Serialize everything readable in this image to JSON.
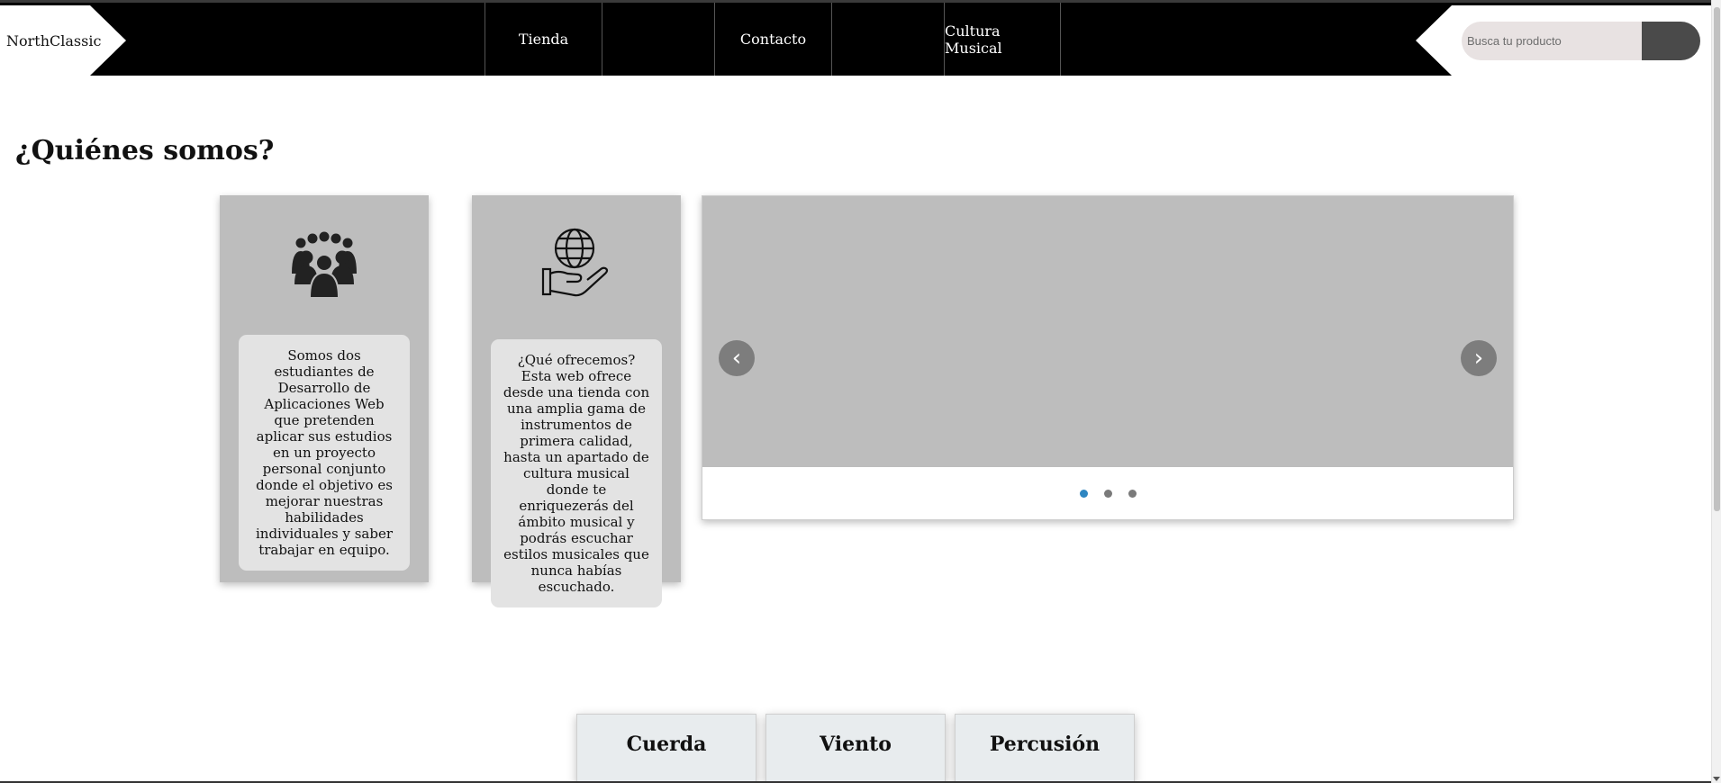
{
  "navbar": {
    "brand": "NorthClassic",
    "links": [
      "Tienda",
      "",
      "Contacto",
      "",
      "Cultura Musical"
    ],
    "search": {
      "placeholder": "Busca tu producto"
    }
  },
  "main": {
    "title": "¿Quiénes somos?",
    "cards": [
      {
        "icon": "people-group-icon",
        "text": "Somos dos estudiantes de Desarrollo de Aplicaciones Web que pretenden aplicar sus estudios en un proyecto personal conjunto donde el objetivo es mejorar nuestras habilidades individuales y saber trabajar en equipo."
      },
      {
        "icon": "globe-in-hand-icon",
        "text": "¿Qué ofrecemos? Esta web ofrece desde una tienda con una amplia gama de instrumentos de primera calidad, hasta un apartado de cultura musical donde te enriquezerás del ámbito musical y podrás escuchar estilos musicales que nunca habías escuchado."
      }
    ],
    "carousel": {
      "prev": "‹",
      "next": "›",
      "slide_count": 3,
      "active_index": 0
    },
    "categories": [
      "Cuerda",
      "Viento",
      "Percusión"
    ]
  },
  "colors": {
    "navbar_bg": "#000000",
    "card_bg": "#bdbdbd",
    "active_dot": "#2e86c1"
  }
}
